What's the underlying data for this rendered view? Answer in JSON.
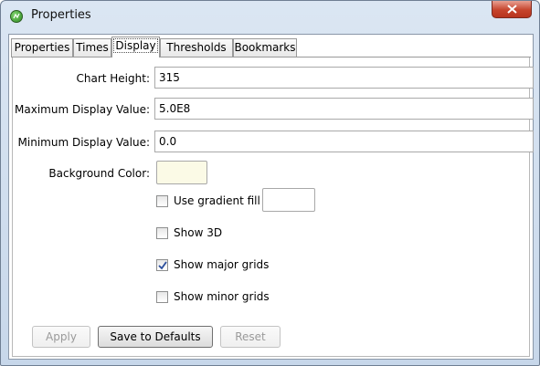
{
  "window": {
    "title": "Properties",
    "close_label": "x"
  },
  "tabs": [
    {
      "label": "Properties"
    },
    {
      "label": "Times"
    },
    {
      "label": "Display",
      "active": true
    },
    {
      "label": "Thresholds"
    },
    {
      "label": "Bookmarks"
    }
  ],
  "form": {
    "chart_height": {
      "label": "Chart Height:",
      "value": "315"
    },
    "max_display": {
      "label": "Maximum Display Value:",
      "value": "5.0E8"
    },
    "min_display": {
      "label": "Minimum Display Value:",
      "value": "0.0"
    },
    "background_color": {
      "label": "Background Color:",
      "color": "#fbfae6"
    },
    "gradient_fill": {
      "label": "Use gradient fill",
      "checked": false,
      "color": "#ffffff"
    },
    "show_3d": {
      "label": "Show 3D",
      "checked": false
    },
    "major_grids": {
      "label": "Show major grids",
      "checked": true
    },
    "minor_grids": {
      "label": "Show minor grids",
      "checked": false
    }
  },
  "buttons": {
    "apply": "Apply",
    "save_defaults": "Save to Defaults",
    "reset": "Reset"
  }
}
